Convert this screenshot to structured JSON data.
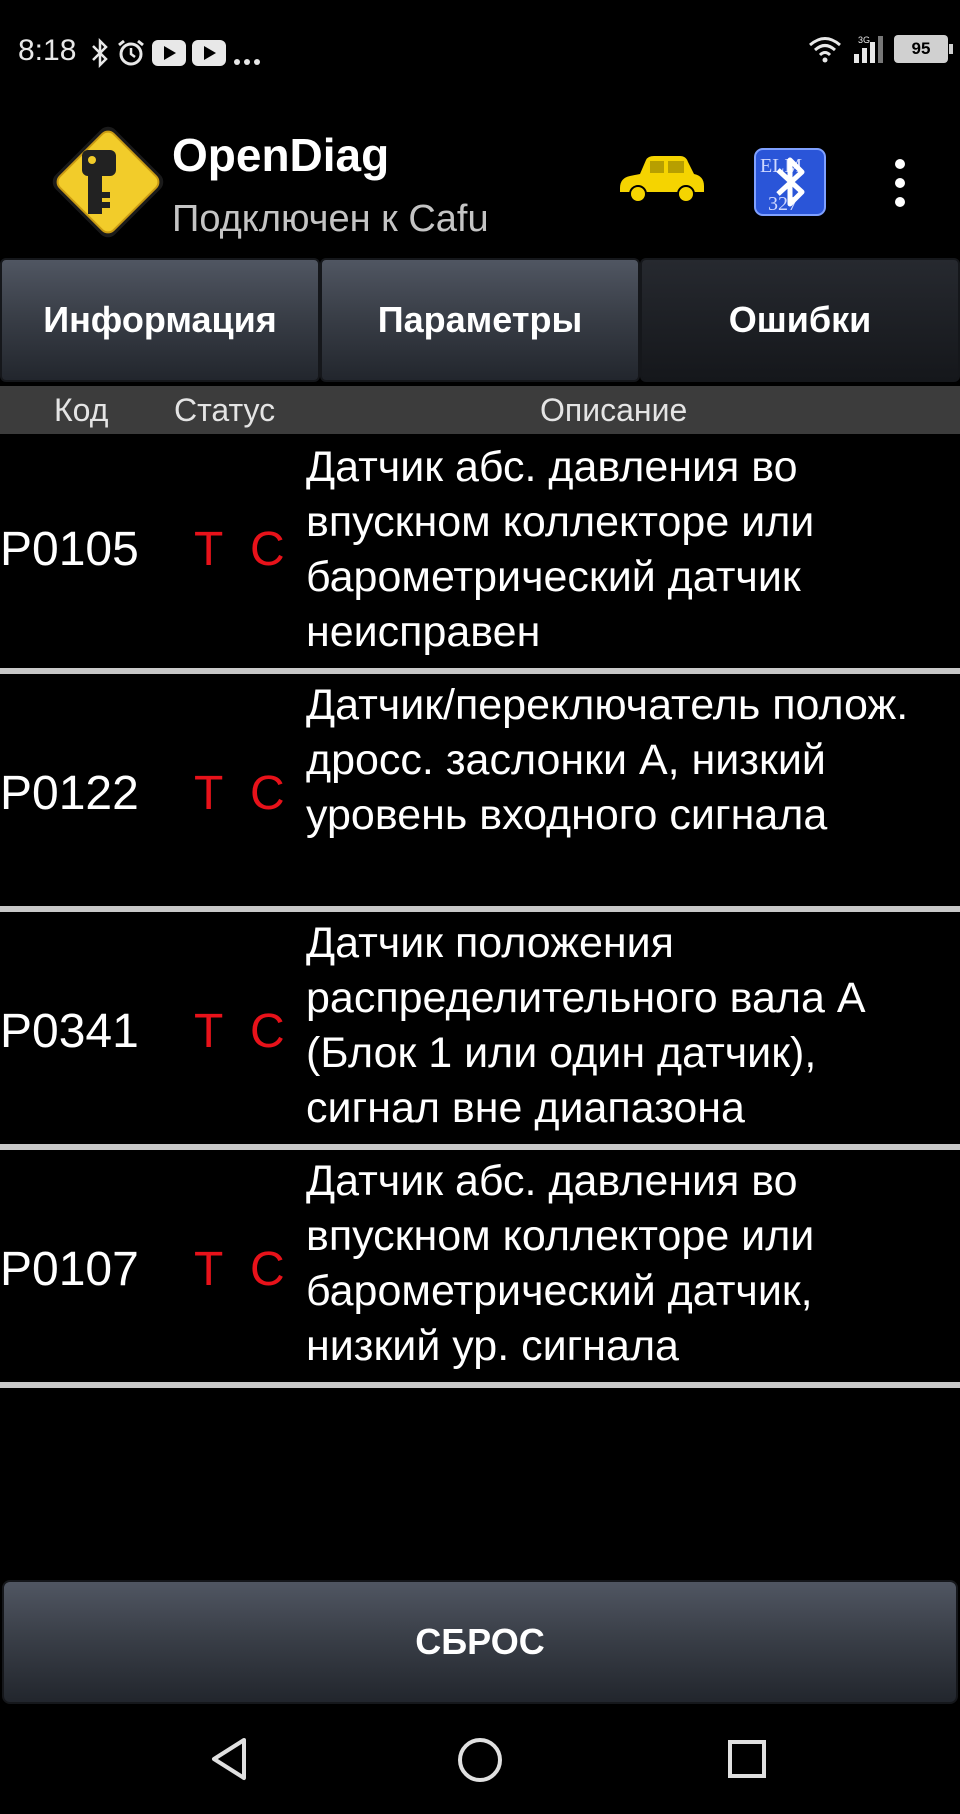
{
  "status_bar": {
    "time": "8:18",
    "battery": "95",
    "network": "3G"
  },
  "app": {
    "title": "OpenDiag",
    "subtitle": "Подключен к Cafu"
  },
  "tabs": [
    {
      "label": "Информация",
      "active": false
    },
    {
      "label": "Параметры",
      "active": false
    },
    {
      "label": "Ошибки",
      "active": true
    }
  ],
  "table": {
    "headers": {
      "code": "Код",
      "status": "Статус",
      "description": "Описание"
    },
    "rows": [
      {
        "code": "P0105",
        "status": [
          "T",
          "C"
        ],
        "description": "Датчик абс. давления во впускном коллекторе или барометрический датчик неисправен"
      },
      {
        "code": "P0122",
        "status": [
          "T",
          "C"
        ],
        "description": "Датчик/переключатель полож. дросс. заслонки А, низкий уровень входного сигнала"
      },
      {
        "code": "P0341",
        "status": [
          "T",
          "C"
        ],
        "description": "Датчик положения распределительного вала А (Блок 1 или один датчик), сигнал вне диапазона"
      },
      {
        "code": "P0107",
        "status": [
          "T",
          "C"
        ],
        "description": "Датчик абс. давления во впускном коллекторе или барометрический датчик, низкий ур. сигнала"
      }
    ]
  },
  "reset_button": {
    "label": "СБРОС"
  },
  "colors": {
    "status_red": "#e8121a",
    "header_bg": "#3c3c3c",
    "car_yellow": "#f5d400"
  },
  "icons": [
    "bluetooth-icon",
    "alarm-icon",
    "youtube-icon",
    "wifi-icon",
    "signal-icon",
    "battery-icon",
    "app-logo-icon",
    "car-icon",
    "elm327-bluetooth-icon",
    "overflow-menu-icon",
    "back-icon",
    "home-icon",
    "recents-icon"
  ]
}
